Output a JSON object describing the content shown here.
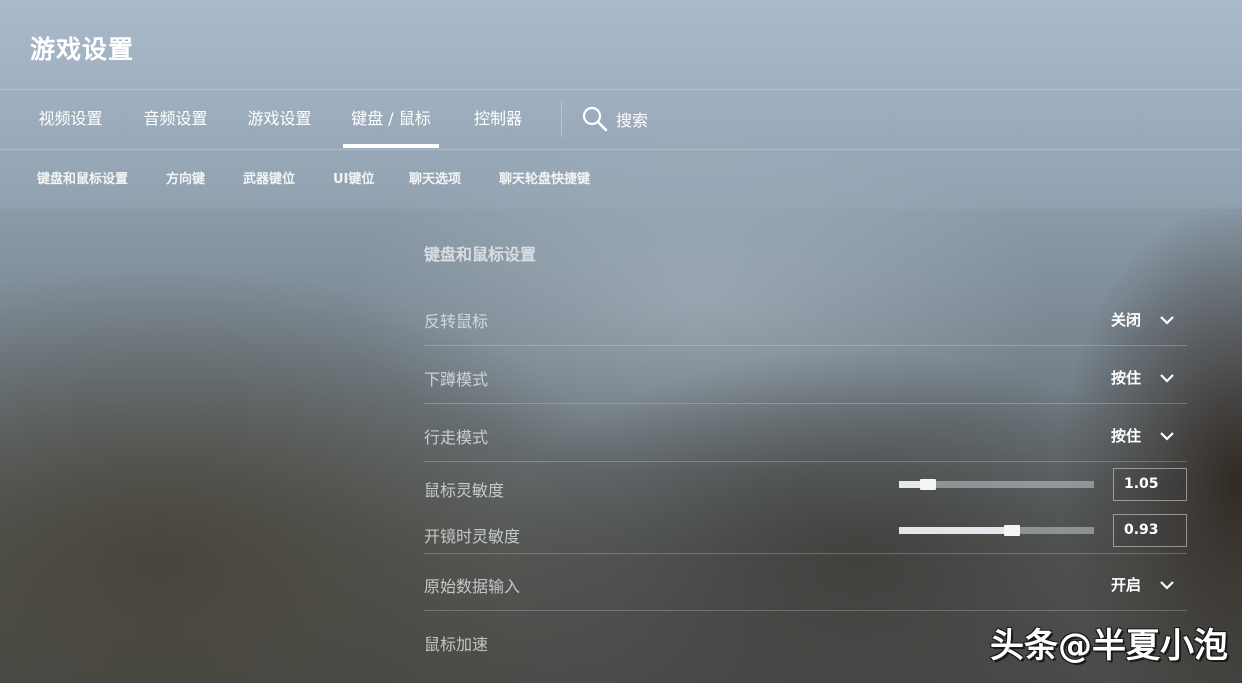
{
  "app": {
    "title": "游戏设置"
  },
  "tabs": [
    {
      "label": "视频设置"
    },
    {
      "label": "音频设置"
    },
    {
      "label": "游戏设置"
    },
    {
      "label": "键盘 / 鼠标",
      "active": true
    },
    {
      "label": "控制器"
    }
  ],
  "search": {
    "label": "搜索",
    "icon": "search-icon"
  },
  "subtabs": [
    {
      "label": "键盘和鼠标设置"
    },
    {
      "label": "方向键"
    },
    {
      "label": "武器键位"
    },
    {
      "label": "UI键位"
    },
    {
      "label": "聊天选项"
    },
    {
      "label": "聊天轮盘快捷键"
    }
  ],
  "section": {
    "title": "键盘和鼠标设置"
  },
  "settings": {
    "invert_mouse": {
      "label": "反转鼠标",
      "value": "关闭"
    },
    "crouch_mode": {
      "label": "下蹲模式",
      "value": "按住"
    },
    "walk_mode": {
      "label": "行走模式",
      "value": "按住"
    },
    "mouse_sensitivity": {
      "label": "鼠标灵敏度",
      "value": "1.05",
      "fraction": 0.15
    },
    "zoom_sensitivity": {
      "label": "开镜时灵敏度",
      "value": "0.93",
      "fraction": 0.58
    },
    "raw_input": {
      "label": "原始数据输入",
      "value": "开启"
    },
    "mouse_accel": {
      "label": "鼠标加速"
    }
  },
  "watermark": {
    "text": "头条@半夏小泡"
  },
  "colors": {
    "accent": "#ffffff",
    "divider": "rgba(255,255,255,0.22)"
  }
}
